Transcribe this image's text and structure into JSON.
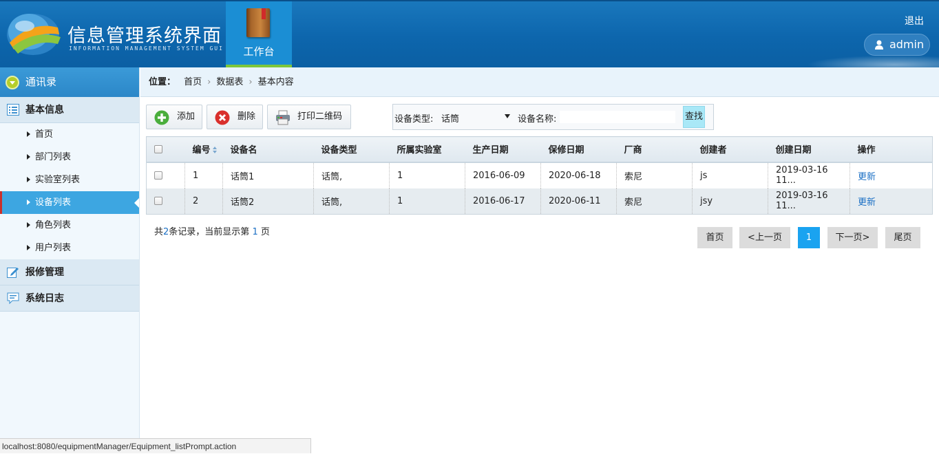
{
  "header": {
    "brand_title": "信息管理系统界面",
    "brand_subtitle": "INFORMATION MANAGEMENT SYSTEM GUI",
    "workbench_label": "工作台",
    "logout_label": "退出",
    "username": "admin"
  },
  "sidebar": {
    "header_label": "通讯录",
    "groups": [
      {
        "label": "基本信息",
        "icon": "list-icon"
      },
      {
        "label": "报修管理",
        "icon": "edit-icon"
      },
      {
        "label": "系统日志",
        "icon": "comment-icon"
      }
    ],
    "items": [
      {
        "label": "首页"
      },
      {
        "label": "部门列表"
      },
      {
        "label": "实验室列表"
      },
      {
        "label": "设备列表",
        "active": true
      },
      {
        "label": "角色列表"
      },
      {
        "label": "用户列表"
      }
    ]
  },
  "breadcrumb": {
    "prefix": "位置：",
    "items": [
      "首页",
      "数据表",
      "基本内容"
    ]
  },
  "toolbar": {
    "add_label": "添加",
    "delete_label": "删除",
    "print_label": "打印二维码"
  },
  "search": {
    "type_label": "设备类型:",
    "type_value": "话筒",
    "name_label": "设备名称:",
    "name_value": "",
    "button_label": "查找"
  },
  "table": {
    "columns": [
      "编号",
      "设备名",
      "设备类型",
      "所属实验室",
      "生产日期",
      "保修日期",
      "厂商",
      "创建者",
      "创建日期",
      "操作"
    ],
    "rows": [
      {
        "id": "1",
        "name": "话筒1",
        "type": "话筒,",
        "lab": "1",
        "produced": "2016-06-09",
        "warranty": "2020-06-18",
        "vendor": "索尼",
        "creator": "js",
        "created": "2019-03-16 11...",
        "action": "更新"
      },
      {
        "id": "2",
        "name": "话筒2",
        "type": "话筒,",
        "lab": "1",
        "produced": "2016-06-17",
        "warranty": "2020-06-11",
        "vendor": "索尼",
        "creator": "jsy",
        "created": "2019-03-16 11...",
        "action": "更新"
      }
    ]
  },
  "summary": {
    "part1": "共",
    "total": "2",
    "part2": "条记录，当前显示第 ",
    "page": "1",
    "part3": " 页"
  },
  "pager": {
    "first": "首页",
    "prev": "<上一页",
    "current": "1",
    "next": "下一页>",
    "last": "尾页"
  },
  "status_url": "localhost:8080/equipmentManager/Equipment_listPrompt.action"
}
